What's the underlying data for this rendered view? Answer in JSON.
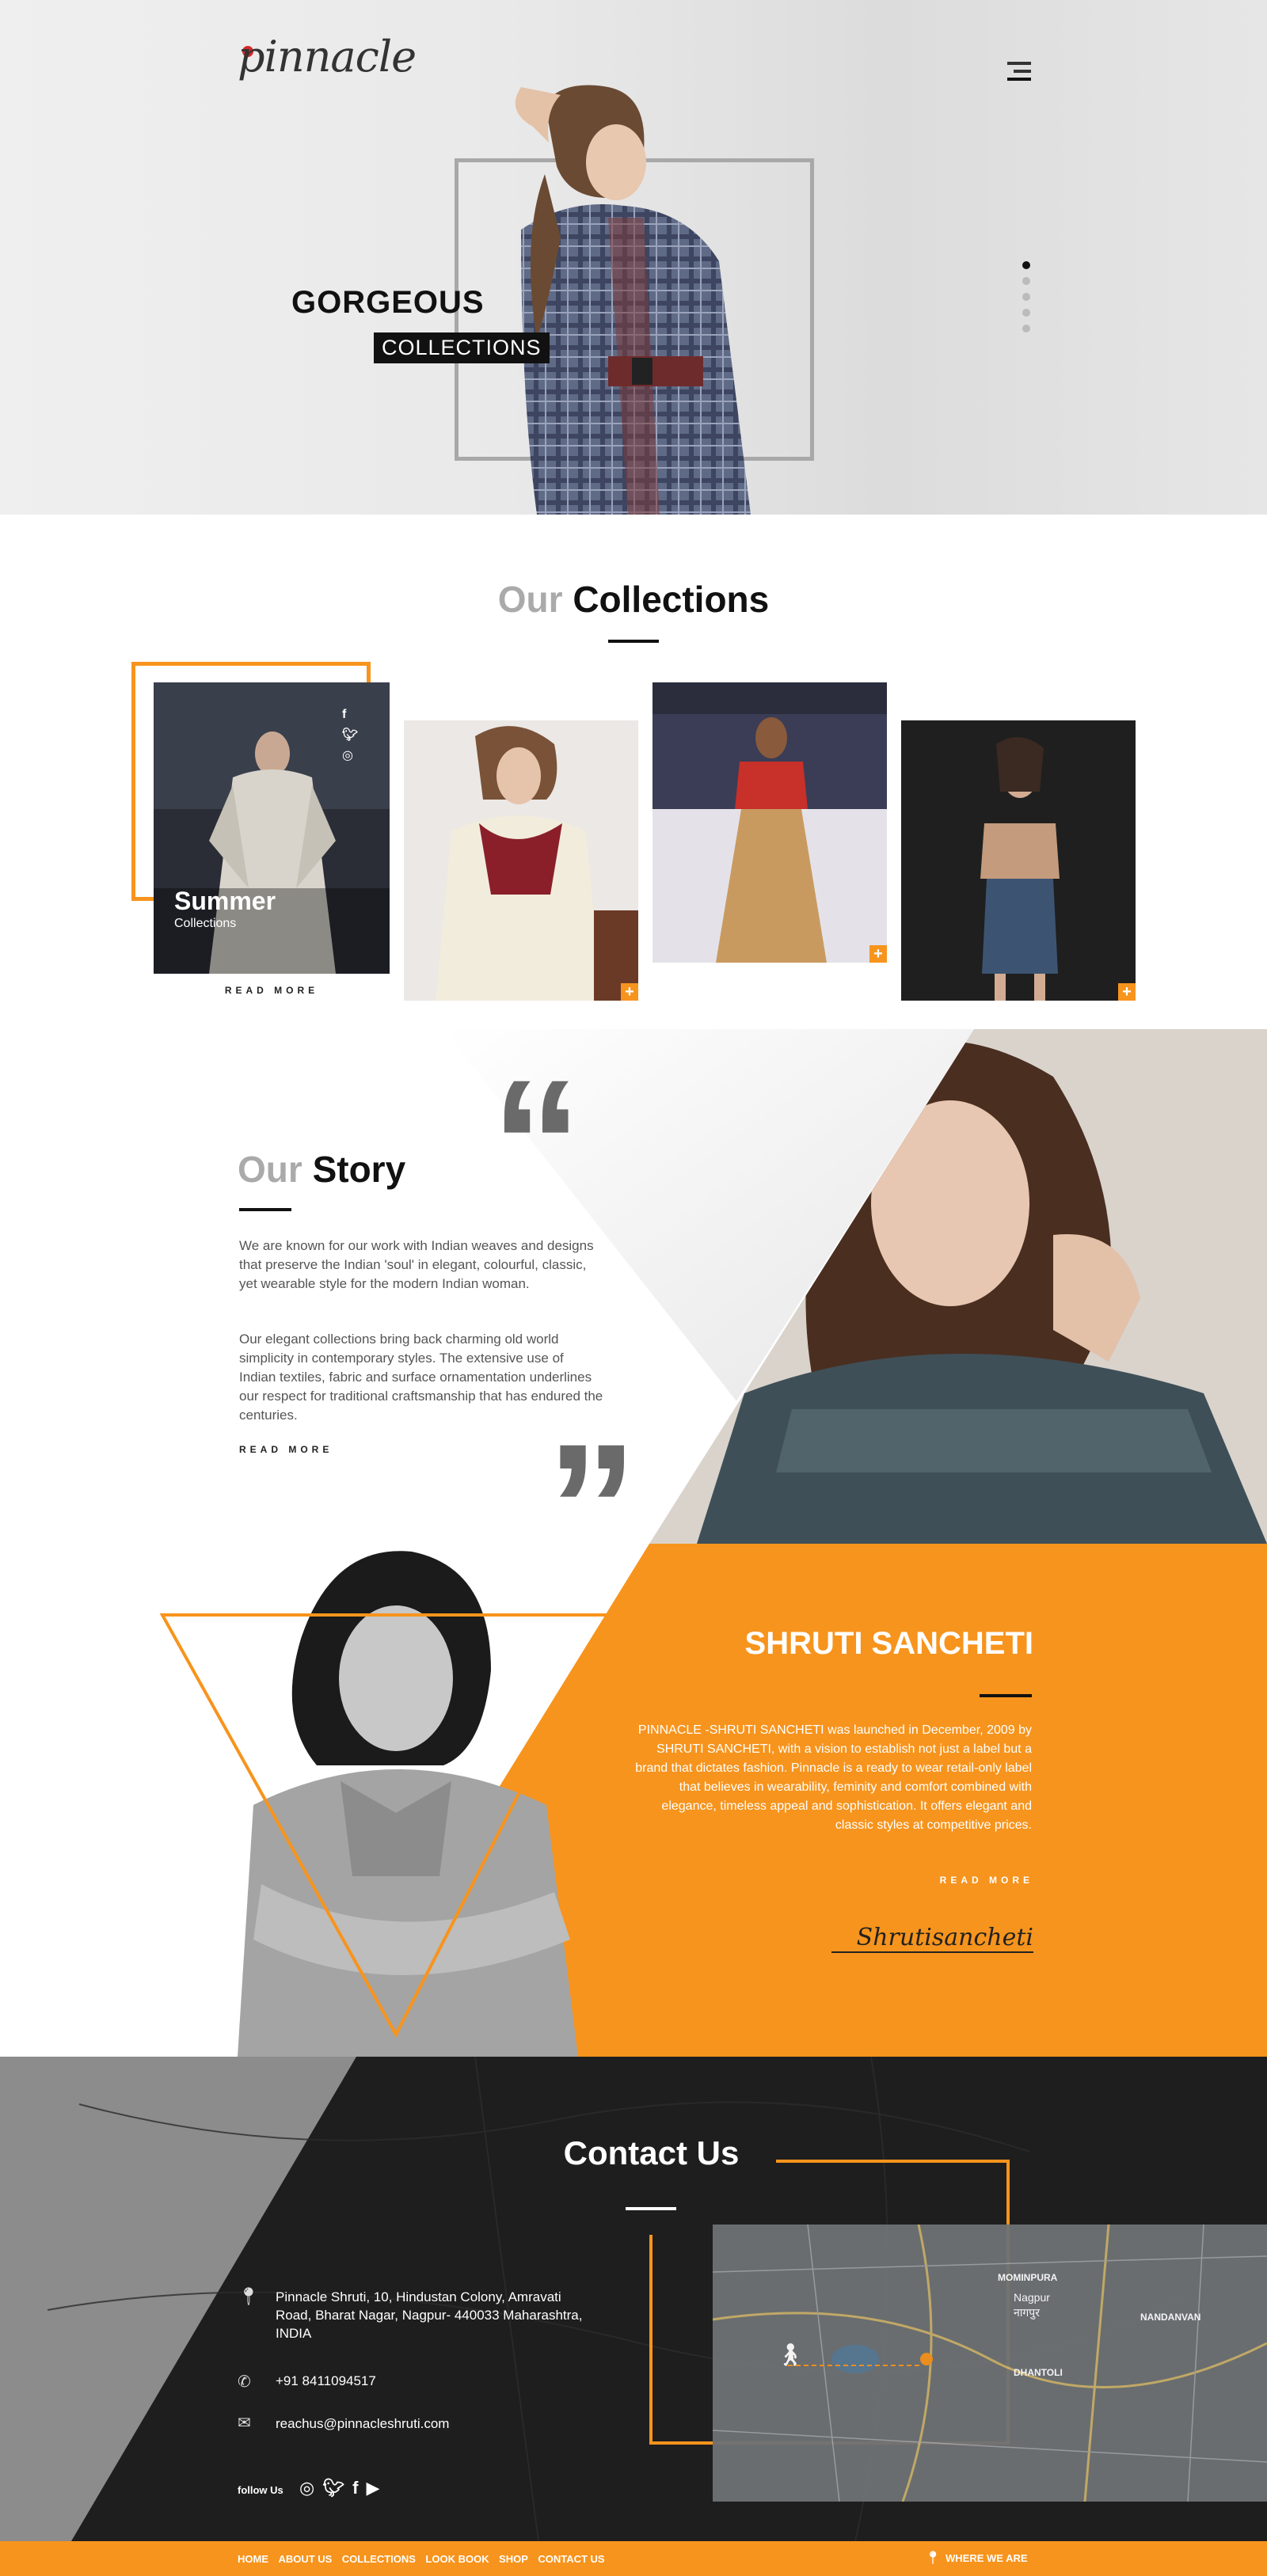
{
  "brand": {
    "logo_text": "pinnacle",
    "accent": "#f7941d",
    "dark": "#1e1e1e"
  },
  "header": {
    "menu_icon": "hamburger-icon"
  },
  "hero": {
    "headline": "GORGEOUS",
    "tag": "COLLECTIONS",
    "slide_count": 5,
    "active_slide": 1
  },
  "collections": {
    "title_light": "Our",
    "title_bold": "Collections",
    "featured": {
      "title": "Summer",
      "subtitle": "Collections",
      "read_more": "READ MORE"
    },
    "social_icons": [
      "facebook-icon",
      "twitter-icon",
      "instagram-icon"
    ],
    "plus_label": "+"
  },
  "story": {
    "title_light": "Our",
    "title_bold": "Story",
    "p1": "We are known for our work with Indian weaves and designs that preserve the Indian 'soul' in elegant, colourful, classic, yet wearable style for the modern Indian woman.",
    "p2": "Our elegant collections bring back charming old world simplicity in contemporary styles. The extensive use of Indian textiles, fabric and surface ornamentation underlines our respect for traditional craftsmanship that has endured the centuries.",
    "read_more": "READ MORE"
  },
  "founder": {
    "name": "SHRUTI SANCHETI",
    "bio": "PINNACLE -SHRUTI SANCHETI was launched in December, 2009 by SHRUTI SANCHETI, with a vision to establish not just a label but a brand that dictates fashion. Pinnacle is a ready to wear retail-only label that believes in wearability, feminity and comfort combined with elegance, timeless appeal and sophistication. It offers elegant and classic styles at competitive prices.",
    "read_more": "READ MORE",
    "signature": "Shrutisancheti"
  },
  "contact": {
    "title": "Contact Us",
    "address": "Pinnacle Shruti, 10, Hindustan Colony, Amravati Road, Bharat Nagar, Nagpur- 440033 Maharashtra, INDIA",
    "phone": "+91 8411094517",
    "email": "reachus@pinnacleshruti.com",
    "follow_label": "follow Us",
    "map_labels": [
      "MOMINPURA",
      "Nagpur",
      "नागपुर",
      "NANDANVAN",
      "DHANTOLI"
    ]
  },
  "footer": {
    "nav": [
      "HOME",
      "ABOUT US",
      "COLLECTIONS",
      "LOOK BOOK",
      "SHOP",
      "CONTACT US"
    ],
    "where_label": "WHERE WE ARE"
  }
}
